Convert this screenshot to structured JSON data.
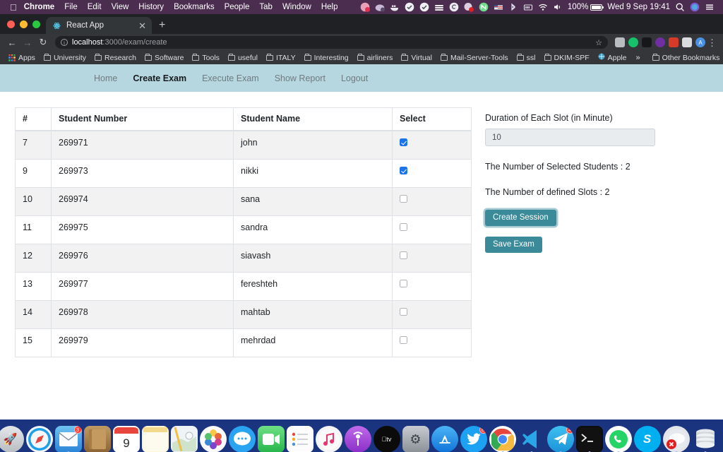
{
  "menubar": {
    "apple_icon": "apple-logo-icon",
    "items": [
      {
        "label": "Chrome",
        "bold": true
      },
      {
        "label": "File",
        "bold": false
      },
      {
        "label": "Edit",
        "bold": false
      },
      {
        "label": "View",
        "bold": false
      },
      {
        "label": "History",
        "bold": false
      },
      {
        "label": "Bookmarks",
        "bold": false
      },
      {
        "label": "People",
        "bold": false
      },
      {
        "label": "Tab",
        "bold": false
      },
      {
        "label": "Window",
        "bold": false
      },
      {
        "label": "Help",
        "bold": false
      }
    ],
    "status_icons": [
      "notification-badge-icon",
      "cloud-sync-icon",
      "docker-whale-icon",
      "shield-check-icon",
      "check-circle-icon",
      "layers-icon",
      "spiral-icon",
      "dropbox-error-icon",
      "nordvpn-icon",
      "flag-us-icon",
      "bluetooth-icon",
      "keyboard-input-icon",
      "wifi-icon",
      "volume-icon"
    ],
    "battery_percent": "100%",
    "clock": "Wed 9 Sep  19:41",
    "search_icon": "spotlight-search-icon",
    "siri_icon": "siri-icon",
    "control_center_icon": "control-center-icon"
  },
  "browser": {
    "traffic_lights": [
      "close",
      "minimize",
      "zoom"
    ],
    "tab": {
      "favicon": "react-app-favicon",
      "title": "React App",
      "close_icon": "close-tab-icon"
    },
    "new_tab_label": "+",
    "toolbar": {
      "back_icon": "back-arrow-icon",
      "forward_icon": "forward-arrow-icon",
      "reload_icon": "reload-icon",
      "site_info_icon": "site-info-icon",
      "url_host": "localhost",
      "url_path": ":3000/exam/create",
      "bookmark_star_icon": "star-icon",
      "extensions": [
        "screencast-icon",
        "grammarly-icon",
        "cube-icon",
        "ghostery-icon",
        "adblock-icon",
        "puzzle-extensions-icon",
        "profile-avatar-icon"
      ],
      "profile_initial": "A",
      "menu_icon": "three-dot-menu-icon"
    },
    "bookmarks": {
      "apps_label": "Apps",
      "apps_icon": "apps-grid-icon",
      "folders": [
        "University",
        "Research",
        "Software",
        "Tools",
        "useful",
        "ITALY",
        "Interesting",
        "airliners",
        "Virtual",
        "Mail-Server-Tools",
        "ssl",
        "DKIM-SPF"
      ],
      "apple_bookmark": "Apple",
      "apple_bookmark_icon": "globe-icon",
      "overflow_label": "»",
      "other_bookmarks": "Other Bookmarks"
    }
  },
  "app": {
    "nav": [
      {
        "label": "Home",
        "active": false
      },
      {
        "label": "Create Exam",
        "active": true
      },
      {
        "label": "Execute Exam",
        "active": false
      },
      {
        "label": "Show Report",
        "active": false
      },
      {
        "label": "Logout",
        "active": false
      }
    ],
    "table": {
      "headers": [
        "#",
        "Student Number",
        "Student Name",
        "Select"
      ],
      "rows": [
        {
          "index": "7",
          "number": "269971",
          "name": "john",
          "selected": true
        },
        {
          "index": "9",
          "number": "269973",
          "name": "nikki",
          "selected": true
        },
        {
          "index": "10",
          "number": "269974",
          "name": "sana",
          "selected": false
        },
        {
          "index": "11",
          "number": "269975",
          "name": "sandra",
          "selected": false
        },
        {
          "index": "12",
          "number": "269976",
          "name": "siavash",
          "selected": false
        },
        {
          "index": "13",
          "number": "269977",
          "name": "fereshteh",
          "selected": false
        },
        {
          "index": "14",
          "number": "269978",
          "name": "mahtab",
          "selected": false
        },
        {
          "index": "15",
          "number": "269979",
          "name": "mehrdad",
          "selected": false
        }
      ]
    },
    "panel": {
      "duration_label": "Duration of Each Slot (in Minute)",
      "duration_value": "10",
      "selected_students_text": "The Number of Selected Students : 2",
      "defined_slots_text": "The Number of defined Slots : 2",
      "create_session_label": "Create Session",
      "save_exam_label": "Save Exam",
      "button_color": "#3a8a99",
      "navbar_color": "#b6d7e0"
    }
  },
  "dock": {
    "items": [
      {
        "name": "finder-icon",
        "glyph": "🖿",
        "color": "#1e8fd5",
        "running": true,
        "badge": ""
      },
      {
        "name": "siri-icon",
        "glyph": "",
        "color": "#1a1a2e",
        "running": false,
        "badge": ""
      },
      {
        "name": "launchpad-icon",
        "glyph": "🚀",
        "color": "#c9ccd1",
        "running": false,
        "badge": ""
      },
      {
        "name": "safari-icon",
        "glyph": "🧭",
        "color": "#1f9fe8",
        "running": false,
        "badge": ""
      },
      {
        "name": "mail-icon",
        "glyph": "✉",
        "color": "#4aa8e8",
        "running": true,
        "badge": "3"
      },
      {
        "name": "contacts-icon",
        "glyph": "📒",
        "color": "#a9783f",
        "running": false,
        "badge": ""
      },
      {
        "name": "calendar-icon",
        "glyph": "9",
        "color": "#ffffff",
        "running": false,
        "badge": ""
      },
      {
        "name": "notes-icon",
        "glyph": "",
        "color": "#fdf5d0",
        "running": false,
        "badge": ""
      },
      {
        "name": "maps-icon",
        "glyph": "",
        "color": "#e8eef0",
        "running": false,
        "badge": ""
      },
      {
        "name": "photos-icon",
        "glyph": "✿",
        "color": "#f6f6f6",
        "running": false,
        "badge": ""
      },
      {
        "name": "messages-icon",
        "glyph": "💬",
        "color": "#2aa3f0",
        "running": false,
        "badge": ""
      },
      {
        "name": "facetime-icon",
        "glyph": "📹",
        "color": "#4cd964",
        "running": false,
        "badge": ""
      },
      {
        "name": "reminders-icon",
        "glyph": "",
        "color": "#fbfbfb",
        "running": false,
        "badge": ""
      },
      {
        "name": "music-icon",
        "glyph": "♫",
        "color": "#f2f2f2",
        "running": false,
        "badge": ""
      },
      {
        "name": "podcasts-icon",
        "glyph": "📡",
        "color": "#9b4dd8",
        "running": false,
        "badge": ""
      },
      {
        "name": "apple-tv-icon",
        "glyph": "tv",
        "color": "#0d0d0d",
        "running": false,
        "badge": ""
      },
      {
        "name": "system-preferences-icon",
        "glyph": "⚙",
        "color": "#9aa0a6",
        "running": false,
        "badge": ""
      },
      {
        "name": "app-store-icon",
        "glyph": "A",
        "color": "#1c8ef0",
        "running": false,
        "badge": ""
      },
      {
        "name": "twitter-icon",
        "glyph": "🐦",
        "color": "#1da1f2",
        "running": false,
        "badge": "8"
      },
      {
        "name": "chrome-icon",
        "glyph": "",
        "color": "#ffffff",
        "running": true,
        "badge": ""
      },
      {
        "name": "vscode-icon",
        "glyph": "⯈",
        "color": "#23a0e8",
        "running": true,
        "badge": ""
      },
      {
        "name": "telegram-icon",
        "glyph": "➤",
        "color": "#2aabee",
        "running": true,
        "badge": "4"
      },
      {
        "name": "terminal-icon",
        "glyph": ">_",
        "color": "#111111",
        "running": true,
        "badge": ""
      },
      {
        "name": "whatsapp-icon",
        "glyph": "✆",
        "color": "#ffffff",
        "running": true,
        "badge": ""
      },
      {
        "name": "skype-icon",
        "glyph": "S",
        "color": "#00aff0",
        "running": true,
        "badge": ""
      },
      {
        "name": "cloud-disconnected-icon",
        "glyph": "",
        "color": "#d8dde1",
        "running": true,
        "badge": ""
      },
      {
        "name": "database-icon",
        "glyph": "",
        "color": "#d0d4d8",
        "running": true,
        "badge": ""
      },
      {
        "name": "vlc-icon",
        "glyph": "▲",
        "color": "#f7f7f7",
        "running": false,
        "badge": ""
      },
      {
        "name": "trash-icon",
        "glyph": "🗑",
        "color": "#b8bcc0",
        "running": false,
        "badge": ""
      }
    ]
  }
}
